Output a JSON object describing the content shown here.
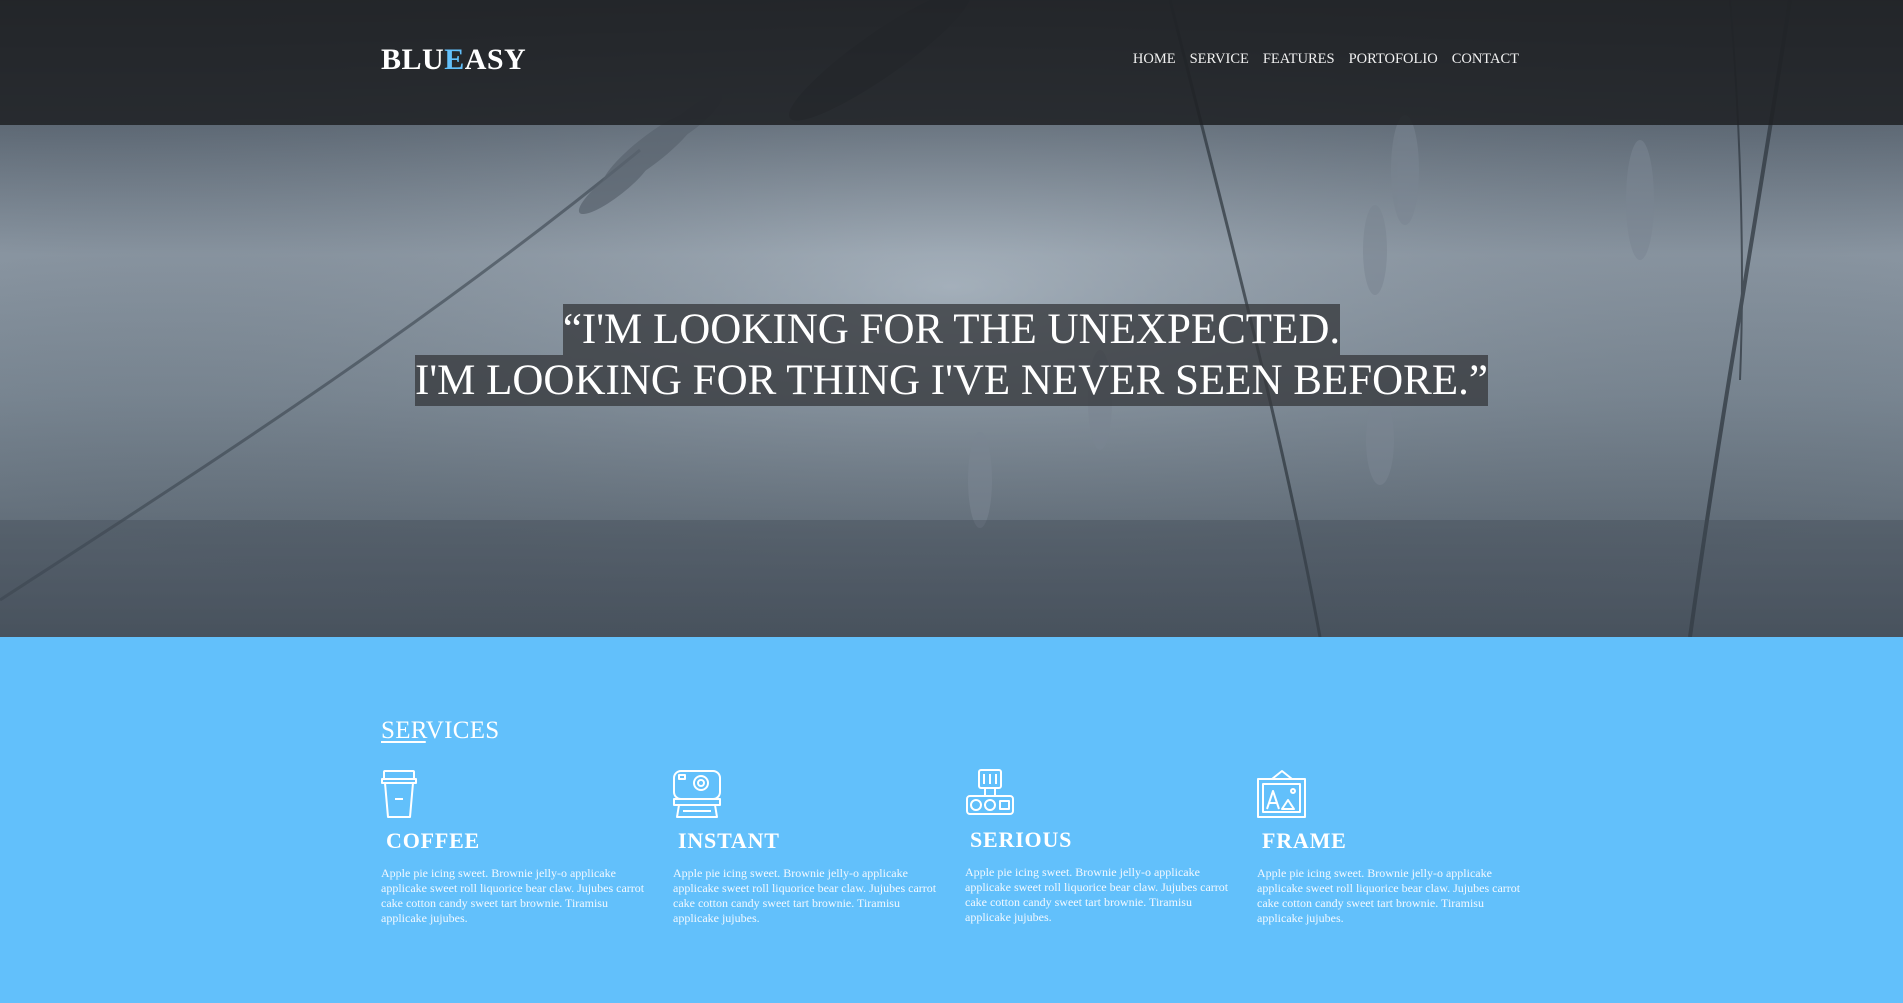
{
  "brand": {
    "logo_part1": "BLU",
    "logo_accent": "E",
    "logo_part2": "ASY",
    "accent_color": "#62c0fb"
  },
  "nav": {
    "items": [
      {
        "label": "HOME"
      },
      {
        "label": "SERVICE"
      },
      {
        "label": "FEATURES"
      },
      {
        "label": "PORTOFOLIO"
      },
      {
        "label": "CONTACT"
      }
    ]
  },
  "hero": {
    "quote_line1": "“I'M LOOKING FOR THE UNEXPECTED.",
    "quote_line2": "I'M LOOKING FOR THING I'VE NEVER SEEN BEFORE.”",
    "background": "wheat-field-photo"
  },
  "services": {
    "title_underlined": "SER",
    "title_rest": "VICES",
    "background_color": "#62c0fb",
    "items": [
      {
        "icon": "coffee-cup-icon",
        "title": "COFFEE",
        "text": "Apple pie icing sweet. Brownie jelly-o applicake applicake sweet roll liquorice bear claw. Jujubes carrot cake cotton candy sweet tart brownie. Tiramisu applicake jujubes."
      },
      {
        "icon": "instant-camera-icon",
        "title": "INSTANT",
        "text": "Apple pie icing sweet. Brownie jelly-o applicake applicake sweet roll liquorice bear claw. Jujubes carrot cake cotton candy sweet tart brownie. Tiramisu applicake jujubes."
      },
      {
        "icon": "vintage-camera-icon",
        "title": "SERIOUS",
        "text": "Apple pie icing sweet. Brownie jelly-o applicake applicake sweet roll liquorice bear claw. Jujubes carrot cake cotton candy sweet tart brownie. Tiramisu applicake jujubes."
      },
      {
        "icon": "picture-frame-icon",
        "title": "FRAME",
        "text": "Apple pie icing sweet. Brownie jelly-o applicake applicake sweet roll liquorice bear claw. Jujubes carrot cake cotton candy sweet tart brownie. Tiramisu applicake jujubes."
      }
    ]
  }
}
